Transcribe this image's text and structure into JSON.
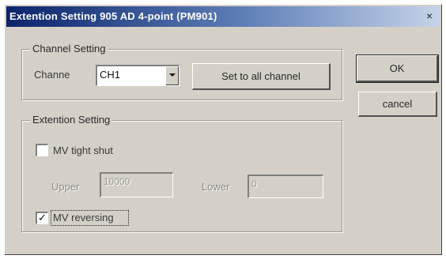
{
  "window": {
    "title": "Extention Setting 905 AD 4-point (PM901)",
    "close_glyph": "×"
  },
  "channel_group": {
    "label": "Channel Setting",
    "channel_label": "Channe",
    "channel_value": "CH1",
    "set_all_button": "Set to all channel"
  },
  "extension_group": {
    "label": "Extention Setting",
    "tight_shut_label": "MV tight shut",
    "tight_shut_checked": false,
    "upper_label": "Upper",
    "upper_value": "10000",
    "lower_label": "Lower",
    "lower_value": "0",
    "reversing_label": "MV reversing",
    "reversing_checked": true,
    "check_glyph": "✓"
  },
  "buttons": {
    "ok": "OK",
    "cancel": "cancel"
  },
  "icons": {
    "close": "close-icon",
    "dropdown": "chevron-down-icon",
    "check": "checkmark-icon"
  }
}
